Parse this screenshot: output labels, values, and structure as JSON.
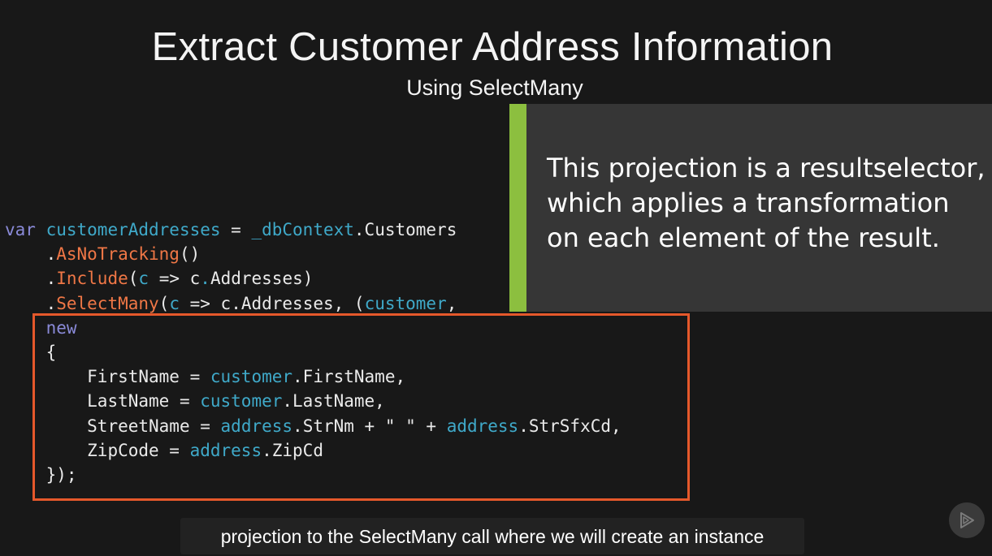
{
  "slide": {
    "title": "Extract Customer Address Information",
    "subtitle": "Using SelectMany"
  },
  "code": {
    "l1_kw": "var",
    "l1_id": "customerAddresses",
    "l1_rest": " = ",
    "l1_ctx": "_dbContext",
    "l1_end": ".Customers",
    "l2_dot": ".",
    "l2_fn": "AsNoTracking",
    "l2_end": "()",
    "l3_dot": ".",
    "l3_fn": "Include",
    "l3_open": "(",
    "l3_param": "c",
    "l3_arrow": " => c",
    "l3_dot2": ".",
    "l3_end": "Addresses)",
    "l4_dot": ".",
    "l4_fn": "SelectMany",
    "l4_open": "(",
    "l4_param": "c",
    "l4_mid": " => c.Addresses, (",
    "l4_param2": "customer",
    "l4_end": ",",
    "l5_kw": "new",
    "l6": "{",
    "l7_a": "FirstName = ",
    "l7_id": "customer",
    "l7_b": ".FirstName,",
    "l8_a": "LastName = ",
    "l8_id": "customer",
    "l8_b": ".LastName,",
    "l9_a": "StreetName = ",
    "l9_id1": "address",
    "l9_b": ".StrNm + \" \" + ",
    "l9_id2": "address",
    "l9_c": ".StrSfxCd,",
    "l10_a": "ZipCode = ",
    "l10_id": "address",
    "l10_b": ".ZipCd",
    "l11": "});"
  },
  "callout": {
    "text": "This projection is a resultselector, which applies a transformation on each element of the result."
  },
  "caption": {
    "text": "projection to the SelectMany call where we will create an instance"
  },
  "colors": {
    "accent_bar": "#8cbf3f",
    "highlight_border": "#e5582b",
    "keyword": "#8a8ad8",
    "identifier": "#3fa9c9",
    "method": "#f07746"
  },
  "icons": {
    "play": "play-icon"
  }
}
